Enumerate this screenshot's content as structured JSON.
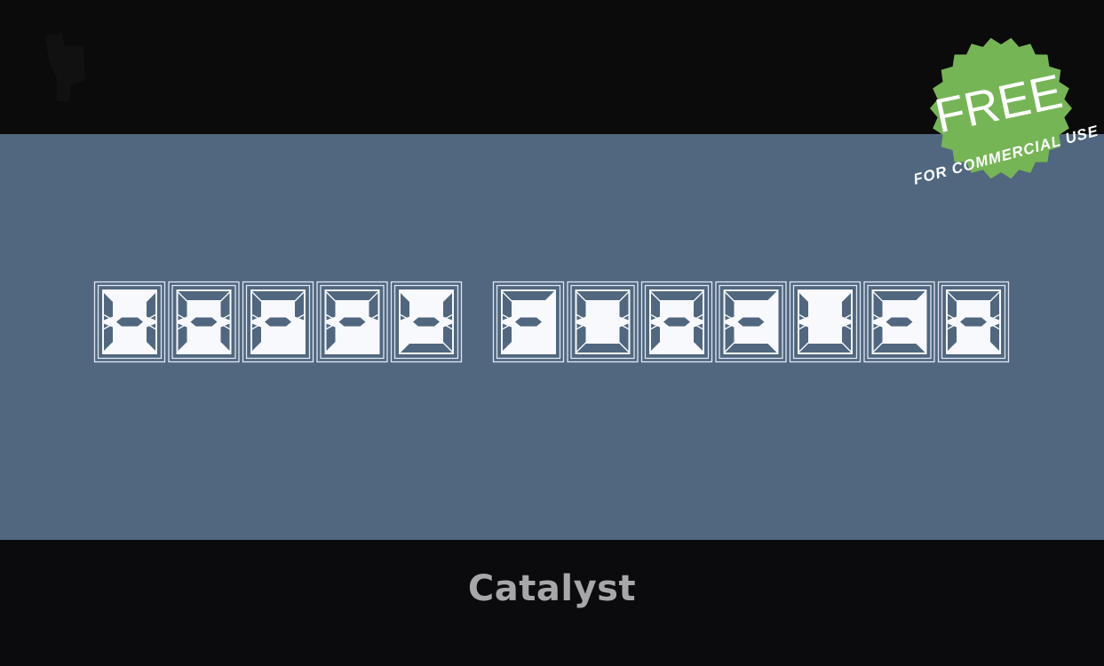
{
  "preview": {
    "sample_text": "HAPPY FOREVER",
    "font_name": "Catalyst",
    "panel_color": "#50677f",
    "glyph_fill": "#f7f9fc",
    "glyph_line": "#dfe8f3",
    "glyphs": [
      {
        "char": "H",
        "segments": "bcefg"
      },
      {
        "char": "A",
        "segments": "abcefg"
      },
      {
        "char": "P",
        "segments": "abefg"
      },
      {
        "char": "P",
        "segments": "abefg"
      },
      {
        "char": "Y",
        "segments": "bcdfg"
      },
      {
        "char": " ",
        "segments": ""
      },
      {
        "char": "F",
        "segments": "aefg"
      },
      {
        "char": "O",
        "segments": "abcdef"
      },
      {
        "char": "R",
        "segments": "abcefg"
      },
      {
        "char": "E",
        "segments": "adefg"
      },
      {
        "char": "V",
        "segments": "bcdef"
      },
      {
        "char": "E",
        "segments": "adefg"
      },
      {
        "char": "R",
        "segments": "abcefg"
      }
    ]
  },
  "badge": {
    "title": "FREE",
    "subtitle": "FOR COMMERCIAL USE",
    "color": "#76b556",
    "icon": "starburst-badge-icon"
  },
  "logo": {
    "icon": "site-logo-icon"
  }
}
